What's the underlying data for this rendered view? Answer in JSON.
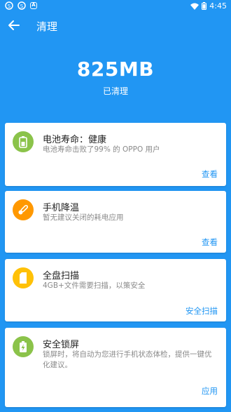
{
  "status_bar": {
    "time": "4:45"
  },
  "app_bar": {
    "title": "清理"
  },
  "hero": {
    "amount": "825MB",
    "label": "已清理"
  },
  "cards": [
    {
      "title": "电池寿命：健康",
      "description": "电池寿命击败了99% 的 OPPO 用户",
      "action": "查看",
      "icon": "battery-icon",
      "color": "#8BC34A"
    },
    {
      "title": "手机降温",
      "description": "暂无建议关闭的耗电应用",
      "action": "查看",
      "icon": "thermometer-icon",
      "color": "#FF9800"
    },
    {
      "title": "全盘扫描",
      "description": "4GB+文件需要扫描，以策安全",
      "action": "安全扫描",
      "icon": "sd-card-icon",
      "color": "#FFC107"
    },
    {
      "title": "安全锁屏",
      "description": "锁屏时，将自动为您进行手机状态体检，提供一键优化建议。",
      "action": "应用",
      "icon": "battery-charging-icon",
      "color": "#8BC34A"
    }
  ]
}
